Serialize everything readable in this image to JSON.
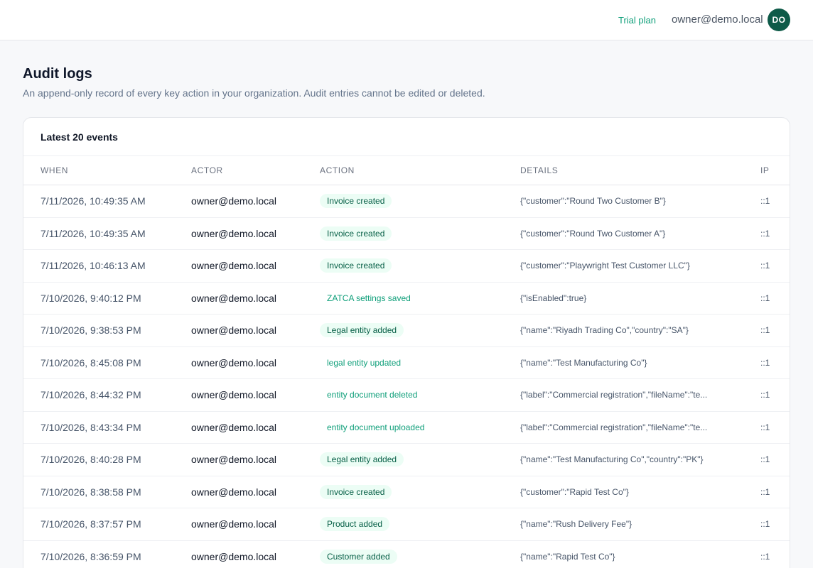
{
  "header": {
    "plan": "Trial plan",
    "user_email": "owner@demo.local",
    "avatar_initials": "DO"
  },
  "page": {
    "title": "Audit logs",
    "description": "An append-only record of every key action in your organization. Audit entries cannot be edited or deleted."
  },
  "card": {
    "title": "Latest 20 events",
    "columns": [
      "When",
      "Actor",
      "Action",
      "Details",
      "IP"
    ]
  },
  "rows": [
    {
      "when": "7/11/2026, 10:49:35 AM",
      "actor": "owner@demo.local",
      "action": "Invoice created",
      "style": "filled",
      "details": "{\"customer\":\"Round Two Customer B\"}",
      "ip": "::1"
    },
    {
      "when": "7/11/2026, 10:49:35 AM",
      "actor": "owner@demo.local",
      "action": "Invoice created",
      "style": "filled",
      "details": "{\"customer\":\"Round Two Customer A\"}",
      "ip": "::1"
    },
    {
      "when": "7/11/2026, 10:46:13 AM",
      "actor": "owner@demo.local",
      "action": "Invoice created",
      "style": "filled",
      "details": "{\"customer\":\"Playwright Test Customer LLC\"}",
      "ip": "::1"
    },
    {
      "when": "7/10/2026, 9:40:12 PM",
      "actor": "owner@demo.local",
      "action": "ZATCA settings saved",
      "style": "plain",
      "details": "{\"isEnabled\":true}",
      "ip": "::1"
    },
    {
      "when": "7/10/2026, 9:38:53 PM",
      "actor": "owner@demo.local",
      "action": "Legal entity added",
      "style": "filled",
      "details": "{\"name\":\"Riyadh Trading Co\",\"country\":\"SA\"}",
      "ip": "::1"
    },
    {
      "when": "7/10/2026, 8:45:08 PM",
      "actor": "owner@demo.local",
      "action": "legal entity updated",
      "style": "plain",
      "details": "{\"name\":\"Test Manufacturing Co\"}",
      "ip": "::1"
    },
    {
      "when": "7/10/2026, 8:44:32 PM",
      "actor": "owner@demo.local",
      "action": "entity document deleted",
      "style": "plain",
      "details": "{\"label\":\"Commercial registration\",\"fileName\":\"te...",
      "ip": "::1"
    },
    {
      "when": "7/10/2026, 8:43:34 PM",
      "actor": "owner@demo.local",
      "action": "entity document uploaded",
      "style": "plain",
      "details": "{\"label\":\"Commercial registration\",\"fileName\":\"te...",
      "ip": "::1"
    },
    {
      "when": "7/10/2026, 8:40:28 PM",
      "actor": "owner@demo.local",
      "action": "Legal entity added",
      "style": "filled",
      "details": "{\"name\":\"Test Manufacturing Co\",\"country\":\"PK\"}",
      "ip": "::1"
    },
    {
      "when": "7/10/2026, 8:38:58 PM",
      "actor": "owner@demo.local",
      "action": "Invoice created",
      "style": "filled",
      "details": "{\"customer\":\"Rapid Test Co\"}",
      "ip": "::1"
    },
    {
      "when": "7/10/2026, 8:37:57 PM",
      "actor": "owner@demo.local",
      "action": "Product added",
      "style": "filled",
      "details": "{\"name\":\"Rush Delivery Fee\"}",
      "ip": "::1"
    },
    {
      "when": "7/10/2026, 8:36:59 PM",
      "actor": "owner@demo.local",
      "action": "Customer added",
      "style": "filled",
      "details": "{\"name\":\"Rapid Test Co\"}",
      "ip": "::1"
    }
  ]
}
